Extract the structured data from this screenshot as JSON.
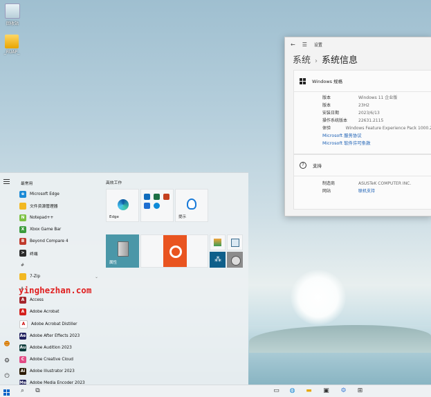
{
  "desktop": {
    "icons": [
      {
        "label": "回收站",
        "icon": "recycle-bin-icon"
      },
      {
        "label": "_RUAP_",
        "icon": "folder-icon"
      }
    ]
  },
  "settings": {
    "window_title": "设置",
    "breadcrumb_parent": "系统",
    "breadcrumb_sep": "›",
    "page_title": "系统信息",
    "windows_spec": {
      "header": "Windows 规格",
      "rows": [
        {
          "k": "版本",
          "v": "Windows 11 企业版"
        },
        {
          "k": "版本",
          "v": "23H2"
        },
        {
          "k": "安装日期",
          "v": "2023/6/13"
        },
        {
          "k": "操作系统版本",
          "v": "22631.2115"
        },
        {
          "k": "体验",
          "v": "Windows Feature Experience Pack 1000.2"
        }
      ],
      "links": [
        "Microsoft 服务协议",
        "Microsoft 软件许可条款"
      ]
    },
    "support": {
      "header": "支持",
      "rows": [
        {
          "k": "制造商",
          "v": "ASUSTeK COMPUTER INC."
        },
        {
          "k": "网站",
          "v": "联机支持"
        }
      ]
    }
  },
  "start_menu": {
    "frequent_label": "最常用",
    "frequent": [
      {
        "label": "Microsoft Edge",
        "color": "#1b8ad6",
        "glyph": "e"
      },
      {
        "label": "文件资源管理器",
        "color": "#f2b822",
        "glyph": ""
      },
      {
        "label": "Notepad++",
        "color": "#7cc142",
        "glyph": "N"
      },
      {
        "label": "Xbox Game Bar",
        "color": "#3c9c3c",
        "glyph": "X"
      },
      {
        "label": "Beyond Compare 4",
        "color": "#c0392b",
        "glyph": "B"
      },
      {
        "label": "终端",
        "color": "#2b2b2b",
        "glyph": ">"
      }
    ],
    "hash_letter": "#",
    "zip": {
      "label": "7-Zip",
      "color": "#f2b822"
    },
    "a_letter": "A",
    "a_apps": [
      {
        "label": "Access",
        "color": "#a4262c",
        "glyph": "A"
      },
      {
        "label": "Adobe Acrobat",
        "color": "#d4201c",
        "glyph": "A"
      },
      {
        "label": "Adobe Acrobat Distiller",
        "color": "#ffffff",
        "glyph": "A"
      },
      {
        "label": "Adobe After Effects 2023",
        "color": "#1f1f5e",
        "glyph": "Ae"
      },
      {
        "label": "Adobe Audition 2023",
        "color": "#0b3b3a",
        "glyph": "Au"
      },
      {
        "label": "Adobe Creative Cloud",
        "color": "#e24b84",
        "glyph": "C"
      },
      {
        "label": "Adobe Illustrator 2023",
        "color": "#2b1a00",
        "glyph": "Ai"
      },
      {
        "label": "Adobe Media Encoder 2023",
        "color": "#1e1e58",
        "glyph": "Me"
      }
    ],
    "tiles_title": "高效工作",
    "tiles": {
      "edge": "Edge",
      "tips": "提示",
      "properties": "属性"
    }
  },
  "watermark": "yinghezhan.com",
  "colors": {
    "accent": "#1a5fb4",
    "ubuntu_orange": "#e95420",
    "teal_tile": "#4a97a8"
  }
}
